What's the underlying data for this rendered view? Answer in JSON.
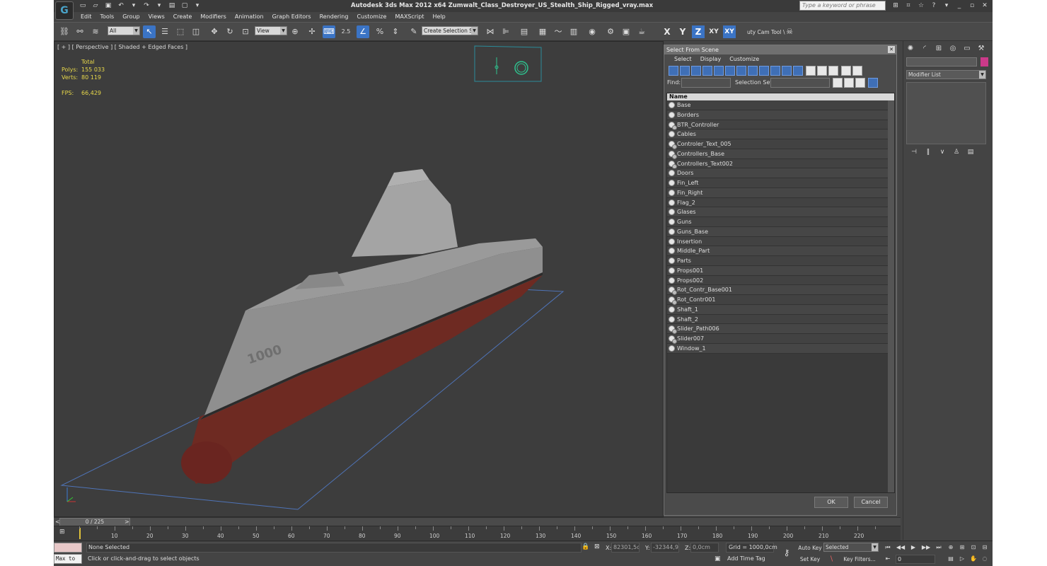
{
  "window": {
    "logo": "G",
    "title": "Autodesk 3ds Max  2012 x64      Zumwalt_Class_Destroyer_US_Stealth_Ship_Rigged_vray.max",
    "search_placeholder": "Type a keyword or phrase"
  },
  "menu": [
    "Edit",
    "Tools",
    "Group",
    "Views",
    "Create",
    "Modifiers",
    "Animation",
    "Graph Editors",
    "Rendering",
    "Customize",
    "MAXScript",
    "Help"
  ],
  "toolbar": {
    "filter_value": "All",
    "refcoord_value": "View",
    "snap_angle_label": "2.5",
    "named_selection_placeholder": "Create Selection Se",
    "axis_x": "X",
    "axis_y": "Y",
    "axis_z": "Z",
    "axis_xy": "XY",
    "axis_xy2": "XY",
    "camtool_label": "uty Cam Tool \\"
  },
  "viewport": {
    "label": "[ + ] [ Perspective ] [ Shaded + Edged Faces ]",
    "stats": {
      "total_label": "Total",
      "polys_label": "Polys:",
      "polys_value": "155 033",
      "verts_label": "Verts:",
      "verts_value": "80 119",
      "fps_label": "FPS:",
      "fps_value": "66,429"
    },
    "hull_number": "1000"
  },
  "dialog": {
    "title": "Select From Scene",
    "menu": [
      "Select",
      "Display",
      "Customize"
    ],
    "find_label": "Find:",
    "selection_set_label": "Selection Set:",
    "column_name": "Name",
    "objects": [
      {
        "name": "Base",
        "multi": false
      },
      {
        "name": "Borders",
        "multi": false
      },
      {
        "name": "BTR_Controller",
        "multi": true
      },
      {
        "name": "Cables",
        "multi": false
      },
      {
        "name": "Controler_Text_005",
        "multi": true
      },
      {
        "name": "Controllers_Base",
        "multi": true
      },
      {
        "name": "Controllers_Text002",
        "multi": true
      },
      {
        "name": "Doors",
        "multi": false
      },
      {
        "name": "Fin_Left",
        "multi": false
      },
      {
        "name": "Fin_Right",
        "multi": false
      },
      {
        "name": "Flag_2",
        "multi": false
      },
      {
        "name": "Glases",
        "multi": false
      },
      {
        "name": "Guns",
        "multi": false
      },
      {
        "name": "Guns_Base",
        "multi": false
      },
      {
        "name": "Insertion",
        "multi": false
      },
      {
        "name": "Middle_Part",
        "multi": false
      },
      {
        "name": "Parts",
        "multi": false
      },
      {
        "name": "Props001",
        "multi": false
      },
      {
        "name": "Props002",
        "multi": false
      },
      {
        "name": "Rot_Contr_Base001",
        "multi": true
      },
      {
        "name": "Rot_Contr001",
        "multi": true
      },
      {
        "name": "Shaft_1",
        "multi": false
      },
      {
        "name": "Shaft_2",
        "multi": false
      },
      {
        "name": "Slider_Path006",
        "multi": true
      },
      {
        "name": "Slider007",
        "multi": true
      },
      {
        "name": "Window_1",
        "multi": false
      }
    ],
    "ok_label": "OK",
    "cancel_label": "Cancel"
  },
  "command_panel": {
    "modifier_list": "Modifier List",
    "object_color": "#cc3a8a"
  },
  "timeline": {
    "frame_display": "0 / 225",
    "prev_arrow": "<",
    "next_arrow": ">",
    "ticks": [
      "10",
      "20",
      "30",
      "40",
      "50",
      "60",
      "70",
      "80",
      "90",
      "100",
      "110",
      "120",
      "130",
      "140",
      "150",
      "160",
      "170",
      "180",
      "190",
      "200",
      "210",
      "220"
    ]
  },
  "status": {
    "maxscript_label": "Max to",
    "selection_status": "None Selected",
    "prompt": "Click or click-and-drag to select objects",
    "x_label": "X:",
    "x_value": "82301,5cm",
    "y_label": "Y:",
    "y_value": "-32344,98",
    "z_label": "Z:",
    "z_value": "0,0cm",
    "grid": "Grid = 1000,0cm",
    "add_time_tag": "Add Time Tag",
    "auto_key": "Auto Key",
    "set_key": "Set Key",
    "selected_dropdown": "Selected",
    "key_filters": "Key Filters...",
    "frame_value": "0"
  }
}
